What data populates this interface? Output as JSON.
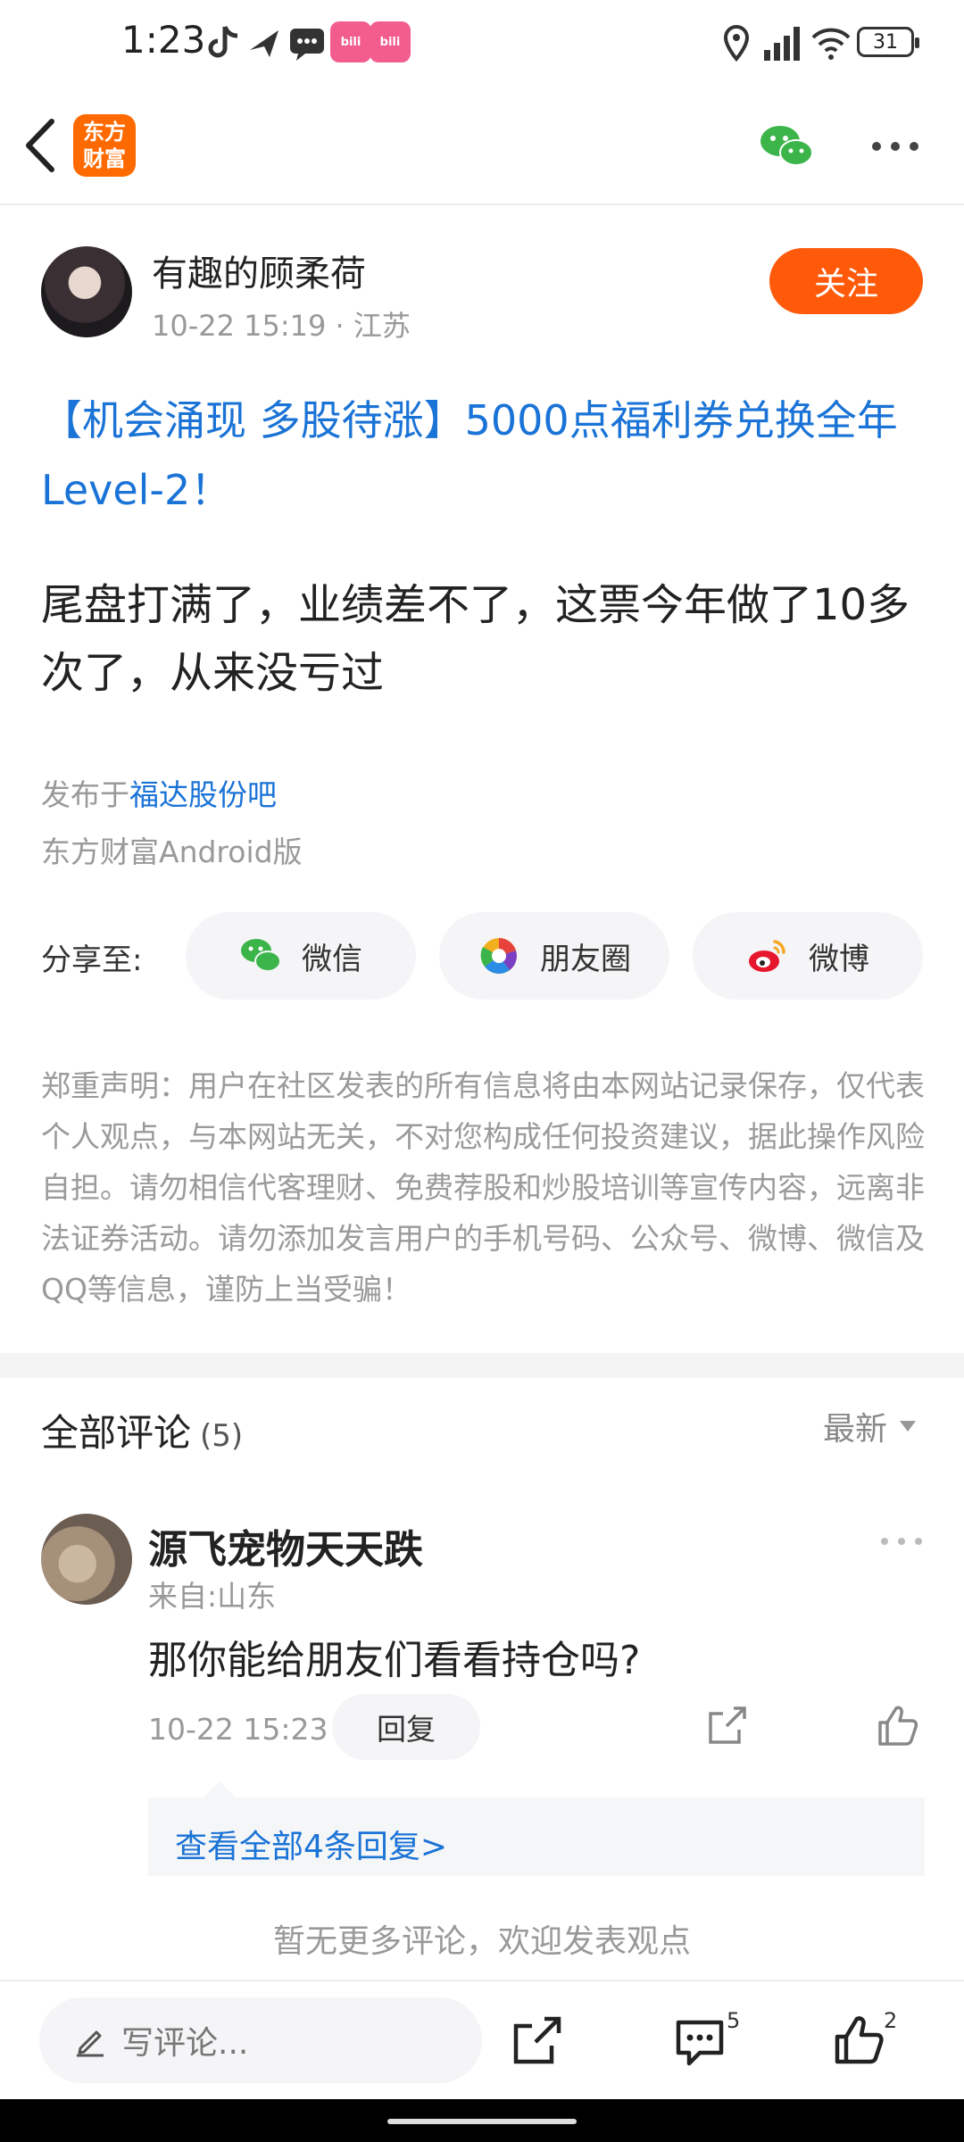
{
  "status_bar": {
    "time": "1:23",
    "battery": "31"
  },
  "header": {
    "logo_line1": "东方",
    "logo_line2": "财富"
  },
  "post": {
    "author": "有趣的顾柔荷",
    "meta": "10-22 15:19 · 江苏",
    "follow_label": "关注",
    "title": "【机会涌现 多股待涨】5000点福利券兑换全年Level-2！",
    "body": "尾盘打满了，业绩差不了，这票今年做了10多次了，从来没亏过",
    "posted_prefix": "发布于",
    "posted_bar": "福达股份吧",
    "client": "东方财富Android版"
  },
  "share": {
    "label": "分享至:",
    "wechat": "微信",
    "moments": "朋友圈",
    "weibo": "微博"
  },
  "disclaimer": "郑重声明：用户在社区发表的所有信息将由本网站记录保存，仅代表个人观点，与本网站无关，不对您构成任何投资建议，据此操作风险自担。请勿相信代客理财、免费荐股和炒股培训等宣传内容，远离非法证券活动。请勿添加发言用户的手机号码、公众号、微博、微信及QQ等信息，谨防上当受骗！",
  "comments": {
    "header": "全部评论",
    "count": "(5)",
    "sort": "最新",
    "items": [
      {
        "user": "源飞宠物天天跌",
        "from": "来自:山东",
        "text": "那你能给朋友们看看持仓吗?",
        "time": "10-22 15:23",
        "reply_label": "回复",
        "replies_link": "查看全部4条回复>"
      }
    ],
    "no_more": "暂无更多评论，欢迎发表观点"
  },
  "bottom_bar": {
    "input_placeholder": "写评论...",
    "comment_count": "5",
    "like_count": "2"
  },
  "colors": {
    "accent": "#ff5a0a",
    "link": "#1a73d6",
    "brand": "#ff6a00"
  }
}
